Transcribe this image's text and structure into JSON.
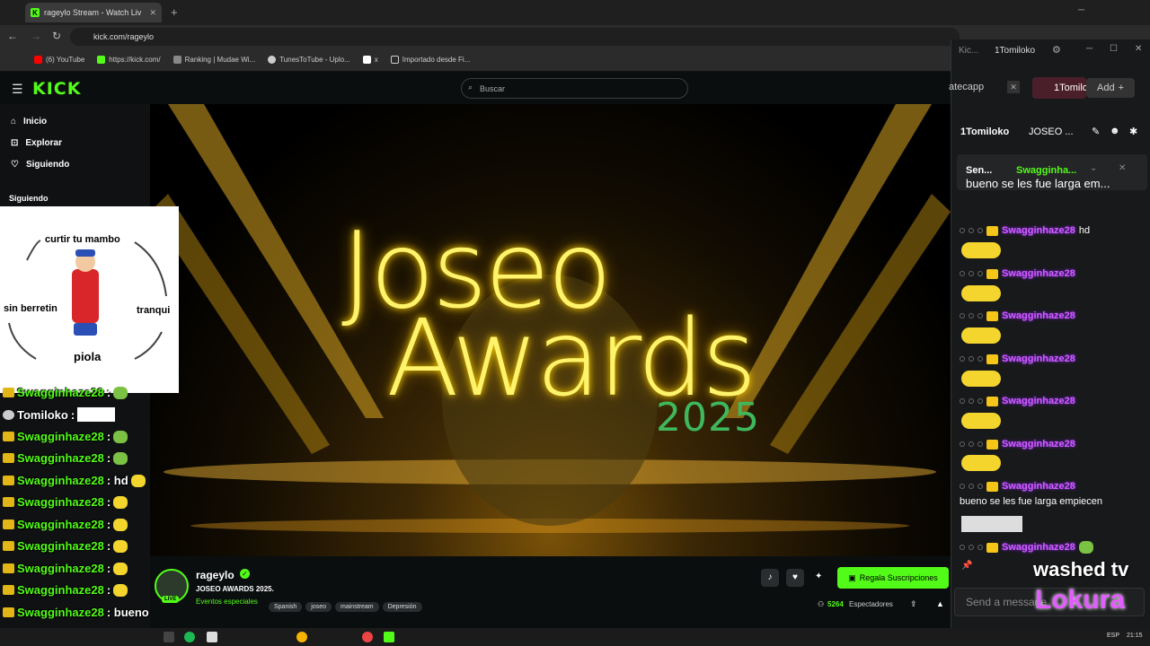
{
  "browser": {
    "tab_title": "rageylo Stream - Watch Liv",
    "url": "kick.com/rageylo",
    "bookmarks": [
      "(6) YouTube",
      "https://kick.com/",
      "Ranking | Mudae Wi...",
      "TunesToTube - Uplo...",
      "x",
      "Importado desde Fi..."
    ]
  },
  "kick": {
    "logo": "KICK",
    "search_placeholder": "Buscar",
    "nav": [
      "Inicio",
      "Explorar",
      "Siguiendo"
    ],
    "following_header": "Siguiendo"
  },
  "meme": {
    "top": "curtir tu mambo",
    "left": "sin berretin",
    "right": "tranqui",
    "bottom": "piola"
  },
  "video": {
    "title_line1": "Joseo",
    "title_line2": "Awards",
    "year": "2025"
  },
  "stream": {
    "streamer": "rageylo",
    "title": "JOSEO AWARDS 2025.",
    "category": "Eventos especiales",
    "tags": [
      "Spanish",
      "joseo",
      "mainstream",
      "Depresión"
    ],
    "viewers": "5264",
    "viewers_label": "Espectadores",
    "sub_button": "Regala Suscripciones",
    "live_badge": "LIVE"
  },
  "overlay_chat": [
    {
      "user": "Swagginhaze28",
      "text": ":"
    },
    {
      "user": "Tomiloko",
      "text": ":"
    },
    {
      "user": "Swagginhaze28",
      "text": ":"
    },
    {
      "user": "Swagginhaze28",
      "text": ":"
    },
    {
      "user": "Swagginhaze28",
      "text": ": hd"
    },
    {
      "user": "Swagginhaze28",
      "text": ":"
    },
    {
      "user": "Swagginhaze28",
      "text": ":"
    },
    {
      "user": "Swagginhaze28",
      "text": ":"
    },
    {
      "user": "Swagginhaze28",
      "text": ":"
    },
    {
      "user": "Swagginhaze28",
      "text": ":"
    },
    {
      "user": "Swagginhaze28",
      "text": ": bueno se les fue larga empiecen"
    },
    {
      "user": "Swagginhaze28",
      "text": ":"
    }
  ],
  "chat_window": {
    "tab_left": "Kic...",
    "tab_user": "1Tomiloko",
    "channel_left": "atecapp",
    "channel_active": "1Tomilo",
    "add_button": "Add",
    "header_user": "1Tomiloko",
    "header_channel": "JOSEO ...",
    "pinned_sender": "Sen...",
    "pinned_user": "Swagginha...",
    "pinned_text": "bueno se les fue larga em...",
    "messages": [
      {
        "user": "Swagginhaze28",
        "text": "hd"
      },
      {
        "user": "Swagginhaze28",
        "text": ""
      },
      {
        "user": "Swagginhaze28",
        "text": ""
      },
      {
        "user": "Swagginhaze28",
        "text": ""
      },
      {
        "user": "Swagginhaze28",
        "text": ""
      },
      {
        "user": "Swagginhaze28",
        "text": ""
      },
      {
        "user": "Swagginhaze28",
        "text": "bueno se les fue larga empiecen"
      },
      {
        "user": "Swagginhaze28",
        "text": ""
      }
    ],
    "input_placeholder": "Send a message",
    "overlay_text_1": "washed tv",
    "overlay_text_2": "Lokura"
  },
  "taskbar": {
    "lang": "ESP",
    "time": "21:15"
  },
  "colors": {
    "kick_green": "#53fc18",
    "gold": "#fff36b",
    "chat_purple": "#d45cff"
  }
}
